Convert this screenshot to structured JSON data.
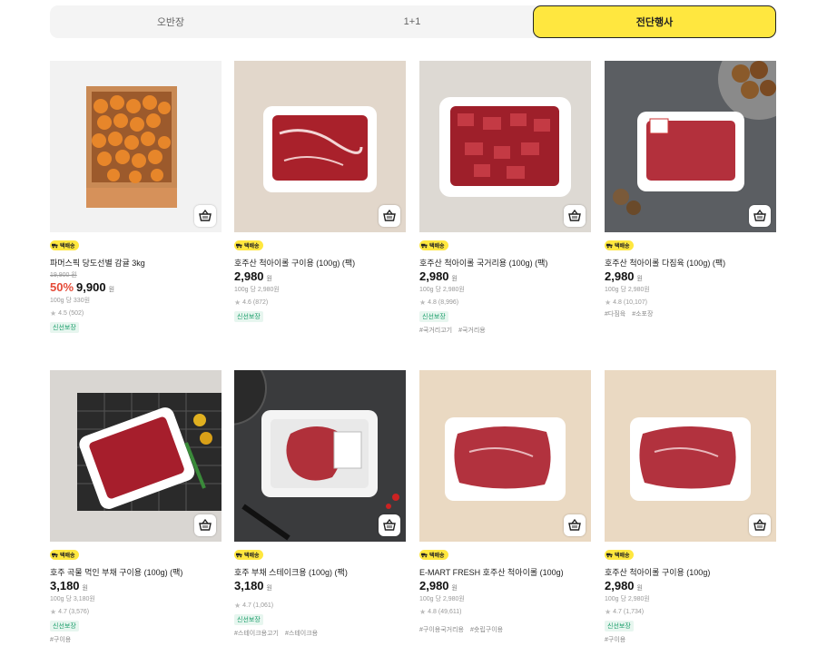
{
  "tabs": [
    {
      "label": "오반장",
      "active": false
    },
    {
      "label": "1+1",
      "active": false
    },
    {
      "label": "전단행사",
      "active": true
    }
  ],
  "badge_label": "택배송",
  "fresh_label": "신선보장",
  "won": "원",
  "products": [
    {
      "name": "파머스픽 당도선별 감귤 3kg",
      "original_price": "19,900 원",
      "discount": "50%",
      "price": "9,900",
      "unit_price": "100g 당 330원",
      "rating": "4.5",
      "reviews": "(502)",
      "tags": []
    },
    {
      "name": "호주산 척아이롤 구이용 (100g) (팩)",
      "original_price": "",
      "discount": "",
      "price": "2,980",
      "unit_price": "100g 당 2,980원",
      "rating": "4.6",
      "reviews": "(872)",
      "tags": []
    },
    {
      "name": "호주산 척아이롤 국거리용 (100g) (팩)",
      "original_price": "",
      "discount": "",
      "price": "2,980",
      "unit_price": "100g 당 2,980원",
      "rating": "4.8",
      "reviews": "(8,996)",
      "tags": [
        "#국거리고기",
        "#국거리용"
      ]
    },
    {
      "name": "호주산 척아이롤 다짐육 (100g) (팩)",
      "original_price": "",
      "discount": "",
      "price": "2,980",
      "unit_price": "100g 당 2,980원",
      "rating": "4.8",
      "reviews": "(10,107)",
      "tags": [
        "#다짐육",
        "#소포장"
      ]
    },
    {
      "name": "호주 곡물 먹인 부채 구이용 (100g) (팩)",
      "original_price": "",
      "discount": "",
      "price": "3,180",
      "unit_price": "100g 당 3,180원",
      "rating": "4.7",
      "reviews": "(3,576)",
      "tags": [
        "#구이용"
      ]
    },
    {
      "name": "호주 부채 스테이크용 (100g) (팩)",
      "original_price": "",
      "discount": "",
      "price": "3,180",
      "unit_price": "",
      "rating": "4.7",
      "reviews": "(1,061)",
      "tags": [
        "#스테이크용고기",
        "#스테이크용"
      ]
    },
    {
      "name": "E-MART FRESH 호주산 척아이롤 (100g)",
      "original_price": "",
      "discount": "",
      "price": "2,980",
      "unit_price": "100g 당 2,980원",
      "rating": "4.8",
      "reviews": "(49,611)",
      "tags": [
        "#구이용국거리용",
        "#숏립구이용"
      ]
    },
    {
      "name": "호주산 척아이롤 구이용 (100g)",
      "original_price": "",
      "discount": "",
      "price": "2,980",
      "unit_price": "100g 당 2,980원",
      "rating": "4.7",
      "reviews": "(1,734)",
      "tags": [
        "#구이용"
      ]
    }
  ],
  "colors": {
    "accent": "#ffe73f",
    "discount": "#e54a37",
    "fresh": "#1a9d6a"
  }
}
